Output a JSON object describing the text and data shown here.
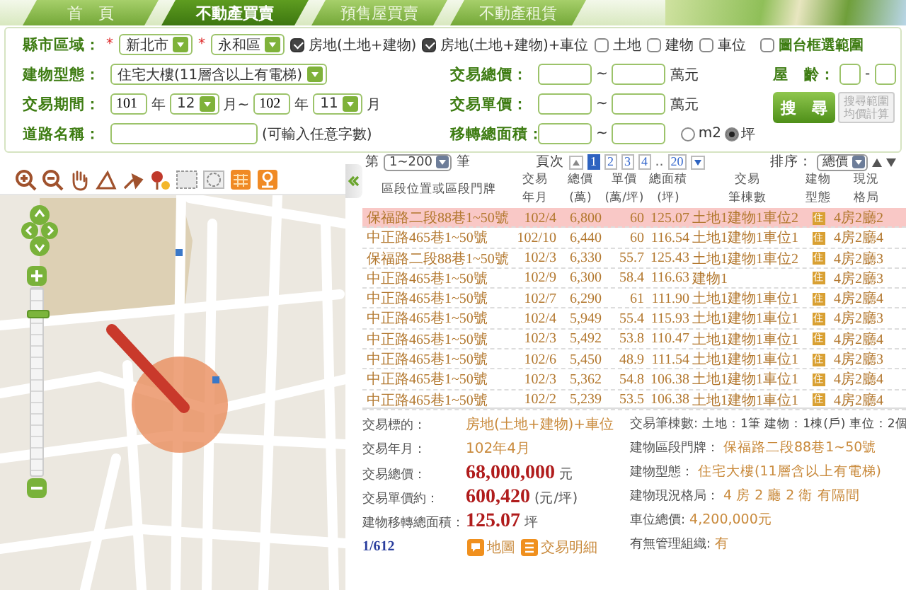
{
  "tabs": [
    {
      "label": "首　頁",
      "selected": false
    },
    {
      "label": "不動產買賣",
      "selected": true
    },
    {
      "label": "預售屋買賣",
      "selected": false
    },
    {
      "label": "不動產租賃",
      "selected": false
    }
  ],
  "search_form": {
    "region": {
      "label": "縣市區域：",
      "city": {
        "required_mark": "*",
        "value": "新北市"
      },
      "district": {
        "required_mark": "*",
        "value": "永和區"
      }
    },
    "type_filters": [
      {
        "label": "房地(土地+建物)",
        "checked": true
      },
      {
        "label": "房地(土地+建物)+車位",
        "checked": true
      },
      {
        "label": "土地",
        "checked": false
      },
      {
        "label": "建物",
        "checked": false
      },
      {
        "label": "車位",
        "checked": false
      }
    ],
    "map_select": {
      "label": "圖台框選範圍",
      "checked": false
    },
    "building_type": {
      "label": "建物型態：",
      "value": "住宅大樓(11層含以上有電梯)"
    },
    "period": {
      "label": "交易期間：",
      "from_year": "101",
      "from_year_unit": "年",
      "from_month": "12",
      "month_sep": "月~",
      "to_year": "102",
      "to_year_unit": "年",
      "to_month": "11",
      "to_month_unit": "月"
    },
    "road": {
      "label": "道路名稱：",
      "hint": "(可輸入任意字數)"
    },
    "total_price": {
      "label": "交易總價：",
      "sep": "~",
      "unit": "萬元"
    },
    "unit_price": {
      "label": "交易單價：",
      "sep": "~",
      "unit": "萬元"
    },
    "area": {
      "label": "移轉總面積：",
      "sep": "~",
      "units": [
        {
          "label": "m2",
          "selected": false
        },
        {
          "label": "坪",
          "selected": true
        }
      ]
    },
    "age": {
      "label": "屋　齡：",
      "sep": "-"
    },
    "search_button": "搜　尋",
    "average_button": "搜尋範圍均價計算"
  },
  "map": {
    "zoom": {
      "level": 0.88
    }
  },
  "list": {
    "range_prefix": "第",
    "range": "1~200",
    "range_suffix": "筆",
    "page_label": "頁次",
    "pages": [
      {
        "kind": "page",
        "label": "1",
        "selected": true
      },
      {
        "kind": "page",
        "label": "2",
        "selected": false
      },
      {
        "kind": "page",
        "label": "3",
        "selected": false
      },
      {
        "kind": "page",
        "label": "4",
        "selected": false
      },
      {
        "kind": "gap",
        "label": "..",
        "selected": false
      },
      {
        "kind": "page",
        "label": "20",
        "selected": false
      }
    ],
    "sort_label": "排序：",
    "sort_value": "總價",
    "columns": [
      {
        "lines": [
          "區段位置或區段門牌"
        ]
      },
      {
        "lines": [
          "交易",
          "年月"
        ]
      },
      {
        "lines": [
          "總價",
          "(萬)"
        ]
      },
      {
        "lines": [
          "單價",
          "(萬/坪)"
        ]
      },
      {
        "lines": [
          "總面積",
          "(坪)"
        ]
      },
      {
        "lines": [
          "交易",
          "筆棟數"
        ]
      },
      {
        "lines": [
          "建物",
          "型態"
        ]
      },
      {
        "lines": [
          "現況",
          "格局"
        ]
      }
    ],
    "rows": [
      {
        "address": "保福路二段88巷1~50號",
        "date": "102/4",
        "total": "6,800",
        "unit": "60",
        "area": "125.07",
        "parcels": "土地1建物1車位2",
        "type_badge": "住",
        "layout": "4房2廳2",
        "selected": true
      },
      {
        "address": "中正路465巷1~50號",
        "date": "102/10",
        "total": "6,440",
        "unit": "60",
        "area": "116.54",
        "parcels": "土地1建物1車位1",
        "type_badge": "住",
        "layout": "4房2廳4",
        "selected": false
      },
      {
        "address": "保福路二段88巷1~50號",
        "date": "102/3",
        "total": "6,330",
        "unit": "55.7",
        "area": "125.43",
        "parcels": "土地1建物1車位2",
        "type_badge": "住",
        "layout": "4房2廳3",
        "selected": false
      },
      {
        "address": "中正路465巷1~50號",
        "date": "102/9",
        "total": "6,300",
        "unit": "58.4",
        "area": "116.63",
        "parcels": "建物1",
        "type_badge": "住",
        "layout": "4房2廳3",
        "selected": false
      },
      {
        "address": "中正路465巷1~50號",
        "date": "102/7",
        "total": "6,290",
        "unit": "61",
        "area": "111.90",
        "parcels": "土地1建物1車位1",
        "type_badge": "住",
        "layout": "4房2廳4",
        "selected": false
      },
      {
        "address": "中正路465巷1~50號",
        "date": "102/4",
        "total": "5,949",
        "unit": "55.4",
        "area": "115.93",
        "parcels": "土地1建物1車位1",
        "type_badge": "住",
        "layout": "4房2廳3",
        "selected": false
      },
      {
        "address": "中正路465巷1~50號",
        "date": "102/3",
        "total": "5,492",
        "unit": "53.8",
        "area": "110.47",
        "parcels": "土地1建物1車位1",
        "type_badge": "住",
        "layout": "4房2廳4",
        "selected": false
      },
      {
        "address": "中正路465巷1~50號",
        "date": "102/6",
        "total": "5,450",
        "unit": "48.9",
        "area": "111.54",
        "parcels": "土地1建物1車位1",
        "type_badge": "住",
        "layout": "4房2廳3",
        "selected": false
      },
      {
        "address": "中正路465巷1~50號",
        "date": "102/3",
        "total": "5,362",
        "unit": "54.8",
        "area": "106.38",
        "parcels": "土地1建物1車位1",
        "type_badge": "住",
        "layout": "4房2廳4",
        "selected": false
      },
      {
        "address": "中正路465巷1~50號",
        "date": "102/2",
        "total": "5,239",
        "unit": "53.5",
        "area": "106.38",
        "parcels": "土地1建物1車位1",
        "type_badge": "住",
        "layout": "4房2廳4",
        "selected": false
      }
    ]
  },
  "detail": {
    "left": [
      {
        "kind": "text",
        "label": "交易標的：",
        "value": "房地(土地+建物)+車位"
      },
      {
        "kind": "text",
        "label": "交易年月：",
        "value": "102年4月"
      },
      {
        "kind": "amount",
        "label": "交易總價：",
        "value": "68,000,000",
        "unit": "元"
      },
      {
        "kind": "amount",
        "label": "交易單價約：",
        "value": "600,420",
        "unit": "(元/坪)"
      },
      {
        "kind": "amount",
        "label": "建物移轉總面積：",
        "value": "125.07",
        "unit": "坪"
      }
    ],
    "record": "1/612",
    "actions": [
      {
        "kind": "map",
        "label": "地圖"
      },
      {
        "kind": "list",
        "label": "交易明細"
      }
    ],
    "right": [
      {
        "kind": "plain",
        "label": "交易筆棟數:",
        "value": "土地：1筆 建物：1棟(戶) 車位：2個"
      },
      {
        "kind": "text",
        "label": "建物區段門牌：",
        "value": "保福路二段88巷1~50號"
      },
      {
        "kind": "text",
        "label": "建物型態：",
        "value": "住宅大樓(11層含以上有電梯)"
      },
      {
        "kind": "text",
        "label": "建物現況格局：",
        "value": "4 房 2 廳 2 衛 有隔間"
      },
      {
        "kind": "text",
        "label": "車位總價:",
        "value": "4,200,000元"
      },
      {
        "kind": "text",
        "label": "有無管理組織:",
        "value": "有"
      }
    ]
  }
}
